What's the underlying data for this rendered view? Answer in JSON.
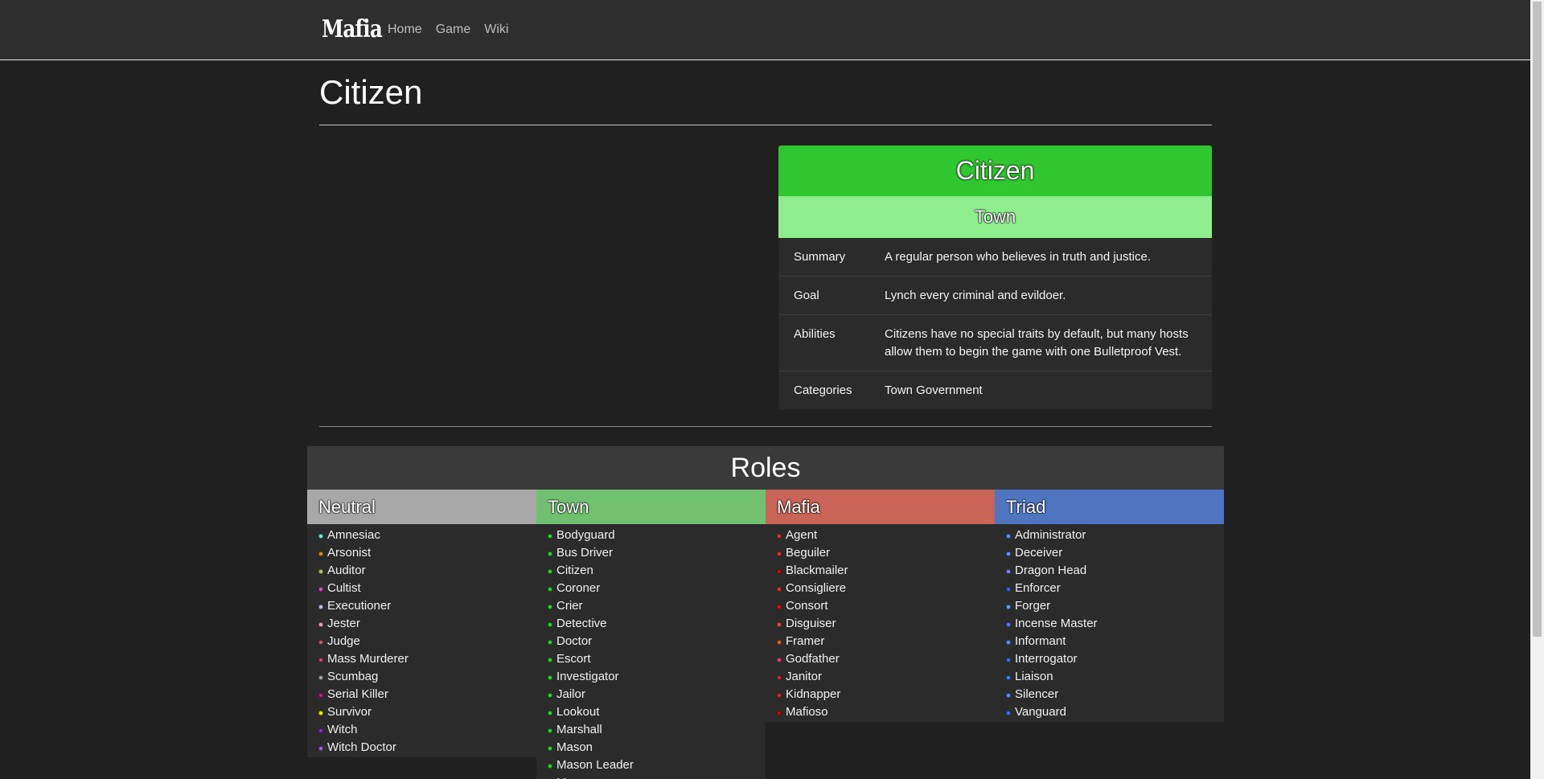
{
  "nav": {
    "brand": "Mafia",
    "links": [
      "Home",
      "Game",
      "Wiki"
    ]
  },
  "page_title": "Citizen",
  "infobox": {
    "title": "Citizen",
    "title_color": "#30c630",
    "faction": "Town",
    "faction_color": "#8eee8e",
    "rows": [
      {
        "key": "Summary",
        "value": "A regular person who believes in truth and justice."
      },
      {
        "key": "Goal",
        "value": "Lynch every criminal and evildoer."
      },
      {
        "key": "Abilities",
        "value": "Citizens have no special traits by default, but many hosts allow them to begin the game with one Bulletproof Vest."
      },
      {
        "key": "Categories",
        "value": "Town Government"
      }
    ]
  },
  "roles": {
    "heading": "Roles",
    "columns": [
      {
        "name": "Neutral",
        "color": "#a8a8a8",
        "items": [
          {
            "label": "Amnesiac",
            "dot": "#7fe0e0"
          },
          {
            "label": "Arsonist",
            "dot": "#e08a20"
          },
          {
            "label": "Auditor",
            "dot": "#a8d060"
          },
          {
            "label": "Cultist",
            "dot": "#d050c0"
          },
          {
            "label": "Executioner",
            "dot": "#c0c0e0"
          },
          {
            "label": "Jester",
            "dot": "#f0a0d0"
          },
          {
            "label": "Judge",
            "dot": "#c06060"
          },
          {
            "label": "Mass Murderer",
            "dot": "#d04060"
          },
          {
            "label": "Scumbag",
            "dot": "#a0a0a0"
          },
          {
            "label": "Serial Killer",
            "dot": "#c02080"
          },
          {
            "label": "Survivor",
            "dot": "#f0f000"
          },
          {
            "label": "Witch",
            "dot": "#8030d0"
          },
          {
            "label": "Witch Doctor",
            "dot": "#a060e0"
          }
        ]
      },
      {
        "name": "Town",
        "color": "#70c070",
        "items": [
          {
            "label": "Bodyguard",
            "dot": "#30d030"
          },
          {
            "label": "Bus Driver",
            "dot": "#30d030"
          },
          {
            "label": "Citizen",
            "dot": "#30d030"
          },
          {
            "label": "Coroner",
            "dot": "#30d030"
          },
          {
            "label": "Crier",
            "dot": "#30d030"
          },
          {
            "label": "Detective",
            "dot": "#30d030"
          },
          {
            "label": "Doctor",
            "dot": "#30d030"
          },
          {
            "label": "Escort",
            "dot": "#30d030"
          },
          {
            "label": "Investigator",
            "dot": "#30d030"
          },
          {
            "label": "Jailor",
            "dot": "#30d030"
          },
          {
            "label": "Lookout",
            "dot": "#30d030"
          },
          {
            "label": "Marshall",
            "dot": "#30d030"
          },
          {
            "label": "Mason",
            "dot": "#30d030"
          },
          {
            "label": "Mason Leader",
            "dot": "#30d030"
          },
          {
            "label": "Mayor",
            "dot": "#30d030"
          }
        ]
      },
      {
        "name": "Mafia",
        "color": "#c86458",
        "items": [
          {
            "label": "Agent",
            "dot": "#e03030"
          },
          {
            "label": "Beguiler",
            "dot": "#e03030"
          },
          {
            "label": "Blackmailer",
            "dot": "#c01010"
          },
          {
            "label": "Consigliere",
            "dot": "#e03030"
          },
          {
            "label": "Consort",
            "dot": "#e01010"
          },
          {
            "label": "Disguiser",
            "dot": "#e05040"
          },
          {
            "label": "Framer",
            "dot": "#e06020"
          },
          {
            "label": "Godfather",
            "dot": "#e04070"
          },
          {
            "label": "Janitor",
            "dot": "#c03030"
          },
          {
            "label": "Kidnapper",
            "dot": "#d03030"
          },
          {
            "label": "Mafioso",
            "dot": "#c01010"
          }
        ]
      },
      {
        "name": "Triad",
        "color": "#4f74c0",
        "items": [
          {
            "label": "Administrator",
            "dot": "#6090ff"
          },
          {
            "label": "Deceiver",
            "dot": "#6090ff"
          },
          {
            "label": "Dragon Head",
            "dot": "#8080ff"
          },
          {
            "label": "Enforcer",
            "dot": "#4060e0"
          },
          {
            "label": "Forger",
            "dot": "#60a0ff"
          },
          {
            "label": "Incense Master",
            "dot": "#6080ff"
          },
          {
            "label": "Informant",
            "dot": "#6090ff"
          },
          {
            "label": "Interrogator",
            "dot": "#4070e0"
          },
          {
            "label": "Liaison",
            "dot": "#4080ff"
          },
          {
            "label": "Silencer",
            "dot": "#6090ff"
          },
          {
            "label": "Vanguard",
            "dot": "#4070ff"
          }
        ]
      }
    ]
  }
}
